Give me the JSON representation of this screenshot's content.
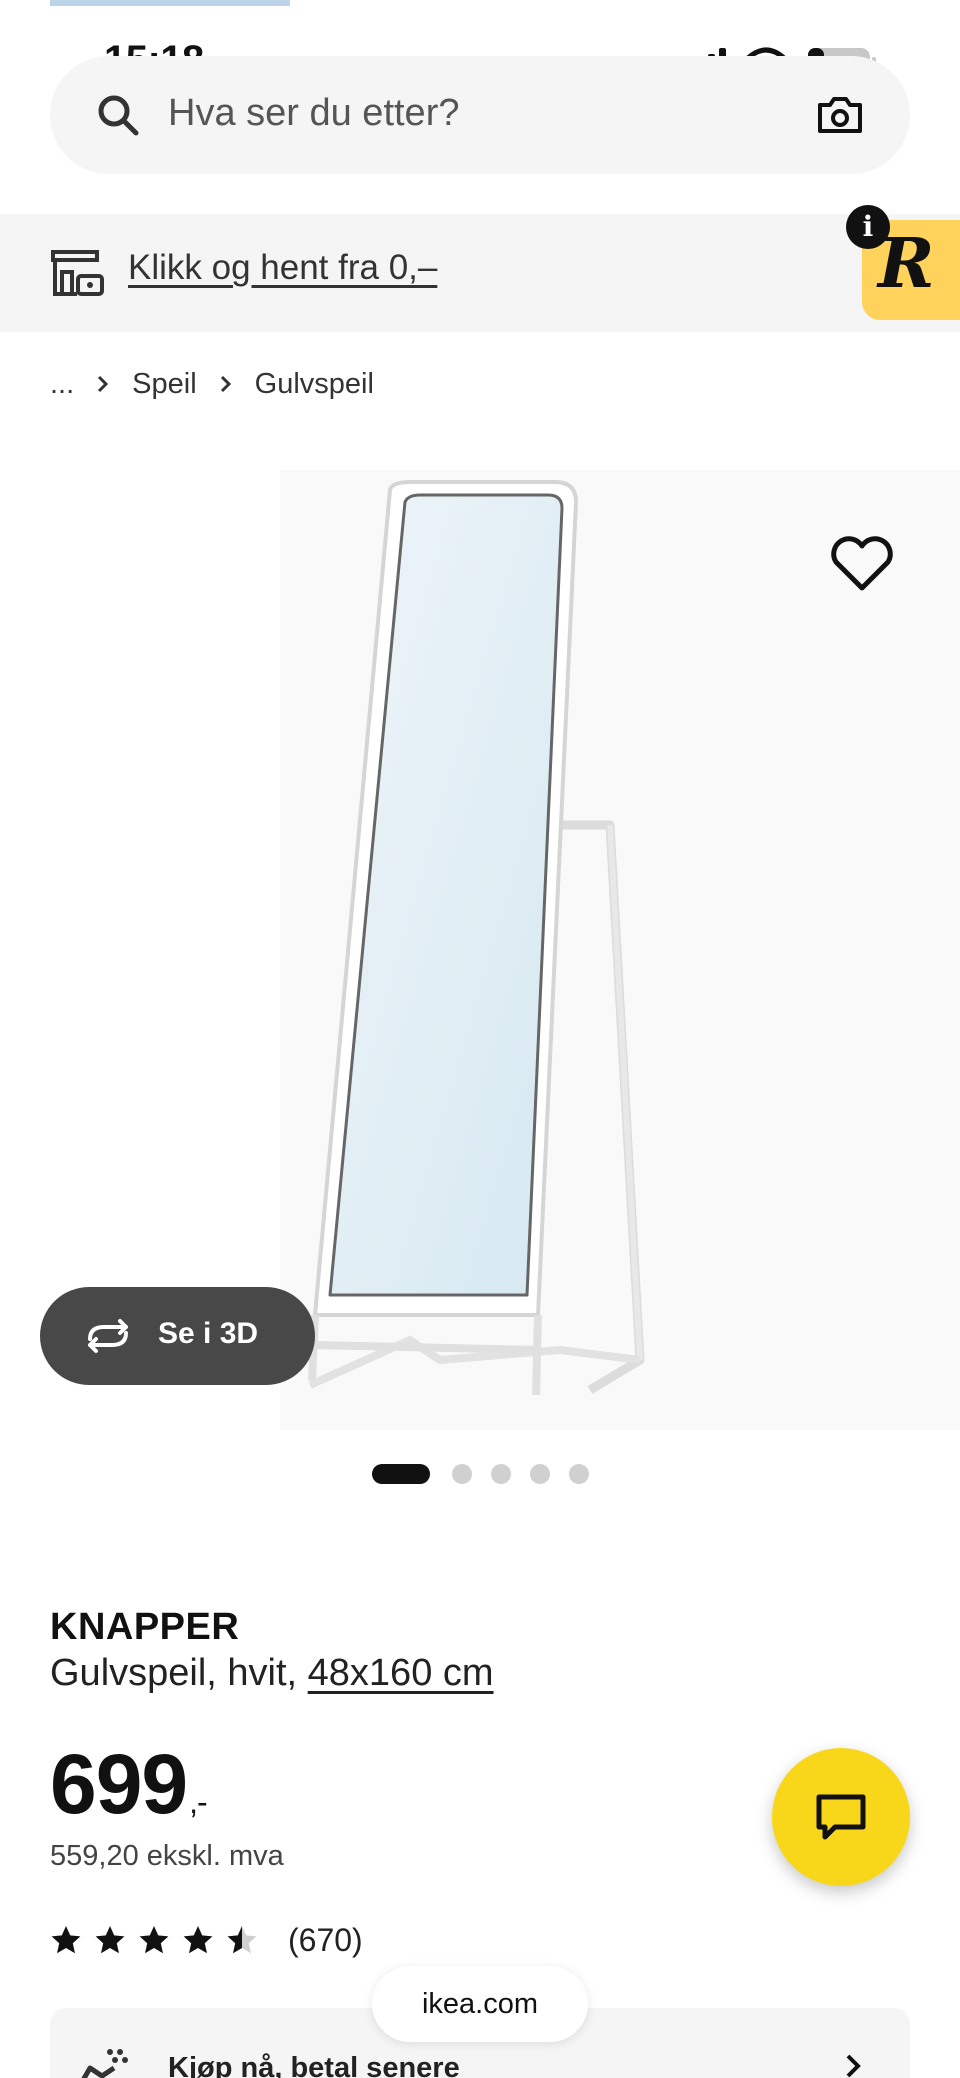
{
  "status_bar": {
    "time": "15:18",
    "battery": "21"
  },
  "search": {
    "placeholder": "Hva ser du etter?"
  },
  "promo": {
    "link_text": "Klikk og hent fra 0,–"
  },
  "badge": {
    "letter": "R",
    "info": "i"
  },
  "breadcrumb": {
    "ellipsis": "...",
    "items": [
      "Speil",
      "Gulvspeil"
    ]
  },
  "gallery": {
    "view_3d_label": "Se i 3D",
    "slide_count": 5,
    "active_slide": 1
  },
  "product": {
    "name": "KNAPPER",
    "description": "Gulvspeil, hvit,",
    "size": "48x160 cm",
    "price": "699",
    "price_suffix": ",-",
    "price_ex_vat": "559,20 ekskl. mva",
    "rating_stars": 4.5,
    "rating_count": "(670)"
  },
  "installment": {
    "label": "Kjøp nå, betal senere"
  },
  "browser": {
    "url": "ikea.com"
  },
  "colors": {
    "accent_yellow": "#f8d71a",
    "badge_yellow": "#ffd25c",
    "dark_button": "#484848"
  }
}
